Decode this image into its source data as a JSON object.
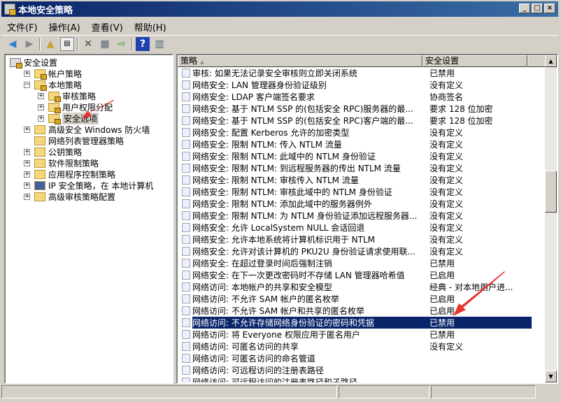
{
  "window": {
    "title": "本地安全策略",
    "buttons": [
      "_",
      "□",
      "×"
    ]
  },
  "menu": [
    "文件(F)",
    "操作(A)",
    "查看(V)",
    "帮助(H)"
  ],
  "toolbar": [
    "back-icon",
    "forward-icon",
    "up-folder-icon",
    "show-hide-tree-icon",
    "delete-icon",
    "properties-icon",
    "export-list-icon",
    "help-icon",
    "console-icon"
  ],
  "tree": [
    {
      "label": "安全设置",
      "level": 0,
      "expander": ""
    },
    {
      "label": "帐户策略",
      "level": 1,
      "expander": "+"
    },
    {
      "label": "本地策略",
      "level": 1,
      "expander": "−"
    },
    {
      "label": "审核策略",
      "level": 2,
      "expander": "+"
    },
    {
      "label": "用户权限分配",
      "level": 2,
      "expander": "+"
    },
    {
      "label": "安全选项",
      "level": 2,
      "expander": "+",
      "selected": true
    },
    {
      "label": "高级安全 Windows 防火墙",
      "level": 1,
      "expander": "+"
    },
    {
      "label": "网络列表管理器策略",
      "level": 1,
      "expander": ""
    },
    {
      "label": "公钥策略",
      "level": 1,
      "expander": "+"
    },
    {
      "label": "软件限制策略",
      "level": 1,
      "expander": "+"
    },
    {
      "label": "应用程序控制策略",
      "level": 1,
      "expander": "+"
    },
    {
      "label": "IP 安全策略，在 本地计算机",
      "level": 1,
      "expander": "+"
    },
    {
      "label": "高级审核策略配置",
      "level": 1,
      "expander": "+"
    }
  ],
  "list": {
    "columns": [
      "策略",
      "安全设置"
    ],
    "rows": [
      [
        "审核: 如果无法记录安全审核则立即关闭系统",
        "已禁用"
      ],
      [
        "网络安全: LAN 管理器身份验证级别",
        "没有定义"
      ],
      [
        "网络安全: LDAP 客户端签名要求",
        "协商签名"
      ],
      [
        "网络安全: 基于 NTLM SSP 的(包括安全 RPC)服务器的最...",
        "要求 128 位加密"
      ],
      [
        "网络安全: 基于 NTLM SSP 的(包括安全 RPC)客户端的最...",
        "要求 128 位加密"
      ],
      [
        "网络安全: 配置 Kerberos 允许的加密类型",
        "没有定义"
      ],
      [
        "网络安全: 限制 NTLM: 传入 NTLM 流量",
        "没有定义"
      ],
      [
        "网络安全: 限制 NTLM: 此域中的 NTLM 身份验证",
        "没有定义"
      ],
      [
        "网络安全: 限制 NTLM: 到远程服务器的传出 NTLM 流量",
        "没有定义"
      ],
      [
        "网络安全: 限制 NTLM: 审核传入 NTLM 流量",
        "没有定义"
      ],
      [
        "网络安全: 限制 NTLM: 审核此域中的 NTLM 身份验证",
        "没有定义"
      ],
      [
        "网络安全: 限制 NTLM: 添加此域中的服务器例外",
        "没有定义"
      ],
      [
        "网络安全: 限制 NTLM: 为 NTLM 身份验证添加远程服务器...",
        "没有定义"
      ],
      [
        "网络安全: 允许 LocalSystem NULL 会话回退",
        "没有定义"
      ],
      [
        "网络安全: 允许本地系统将计算机标识用于 NTLM",
        "没有定义"
      ],
      [
        "网络安全: 允许对该计算机的 PKU2U 身份验证请求使用联...",
        "没有定义"
      ],
      [
        "网络安全: 在超过登录时间后强制注销",
        "已禁用"
      ],
      [
        "网络安全: 在下一次更改密码时不存储 LAN 管理器哈希值",
        "已启用"
      ],
      [
        "网络访问: 本地帐户的共享和安全模型",
        "经典 - 对本地用户进..."
      ],
      [
        "网络访问: 不允许 SAM 帐户的匿名枚举",
        "已启用"
      ],
      [
        "网络访问: 不允许 SAM 帐户和共享的匿名枚举",
        "已启用"
      ],
      [
        "网络访问: 不允许存储网络身份验证的密码和凭据",
        "已禁用"
      ],
      [
        "网络访问: 将 Everyone 权限应用于匿名用户",
        "已禁用"
      ],
      [
        "网络访问: 可匿名访问的共享",
        "没有定义"
      ],
      [
        "网络访问: 可匿名访问的命名管道",
        ""
      ],
      [
        "网络访问: 可远程访问的注册表路径",
        ""
      ],
      [
        "网络访问: 可远程访问的注册表路径和子路径",
        ""
      ]
    ],
    "selected_index": 21
  },
  "colors": {
    "selection": "#0a246a",
    "annotation_arrow": "#e8322d"
  }
}
